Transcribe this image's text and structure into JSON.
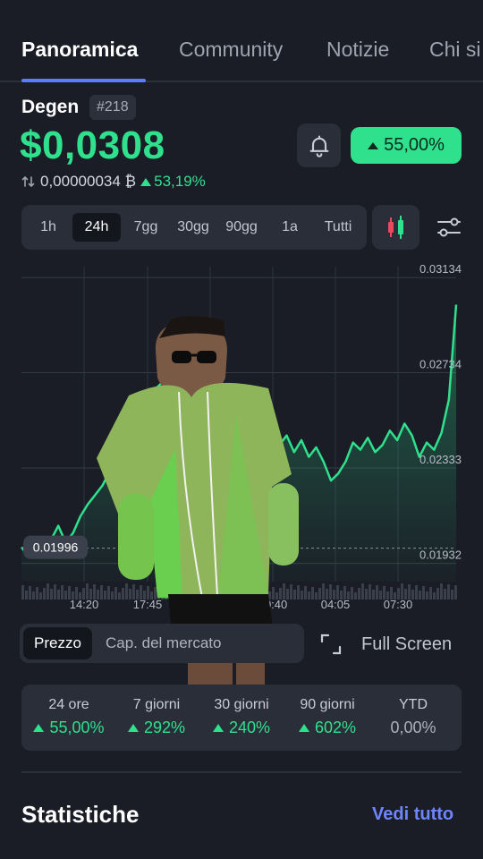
{
  "tabs": [
    {
      "label": "Panoramica",
      "active": true
    },
    {
      "label": "Community",
      "active": false
    },
    {
      "label": "Notizie",
      "active": false
    },
    {
      "label": "Chi si",
      "active": false
    }
  ],
  "coin": {
    "name": "Degen",
    "rank": "#218",
    "price": "$0,0308",
    "change_24h": "55,00%",
    "btc_price": "0,00000034 ₿",
    "btc_change": "53,19%"
  },
  "timeframes": [
    {
      "label": "1h",
      "active": false
    },
    {
      "label": "24h",
      "active": true
    },
    {
      "label": "7gg",
      "active": false
    },
    {
      "label": "30gg",
      "active": false
    },
    {
      "label": "90gg",
      "active": false
    },
    {
      "label": "1a",
      "active": false
    },
    {
      "label": "Tutti",
      "active": false
    }
  ],
  "icons": {
    "bell": "bell-icon",
    "swap": "swap-arrows-icon",
    "candles": "candlestick-icon",
    "settings": "sliders-icon",
    "fullscreen": "expand-icon"
  },
  "chart_data": {
    "type": "line",
    "y_ticks": [
      "0.03134",
      "0.02734",
      "0.02333",
      "0.01932"
    ],
    "x_ticks": [
      "14:20",
      "17:45",
      "21:10",
      "00:40",
      "04:05",
      "07:30"
    ],
    "current_label": "0.01996",
    "ylim": [
      0.0178,
      0.0318
    ],
    "x": [
      "14:20",
      "14:35",
      "14:50",
      "15:05",
      "15:20",
      "15:40",
      "16:00",
      "16:20",
      "16:40",
      "17:00",
      "17:20",
      "17:45",
      "18:10",
      "18:30",
      "19:00",
      "19:20",
      "19:45",
      "20:10",
      "20:35",
      "21:00",
      "21:10",
      "21:30",
      "21:50",
      "22:10",
      "22:30",
      "22:50",
      "23:10",
      "23:30",
      "23:50",
      "00:10",
      "00:40",
      "01:00",
      "01:20",
      "01:40",
      "02:00",
      "02:20",
      "02:40",
      "03:00",
      "03:20",
      "03:40",
      "04:05",
      "04:30",
      "04:50",
      "05:10",
      "05:30",
      "05:50",
      "06:10",
      "06:30",
      "06:50",
      "07:10",
      "07:30",
      "07:50",
      "08:10",
      "08:30",
      "08:50",
      "09:10",
      "09:30",
      "09:50",
      "10:10",
      "10:20"
    ],
    "values": [
      0.02,
      0.0196,
      0.0201,
      0.0198,
      0.0203,
      0.0209,
      0.0202,
      0.0206,
      0.0213,
      0.0218,
      0.0222,
      0.0226,
      0.0232,
      0.0238,
      0.0245,
      0.0252,
      0.0258,
      0.0263,
      0.0266,
      0.0269,
      0.0272,
      0.0268,
      0.0262,
      0.0266,
      0.0258,
      0.026,
      0.0255,
      0.0259,
      0.0252,
      0.0256,
      0.0249,
      0.0254,
      0.0263,
      0.0258,
      0.025,
      0.0243,
      0.0247,
      0.024,
      0.0245,
      0.0238,
      0.0242,
      0.0236,
      0.0228,
      0.0231,
      0.0236,
      0.0244,
      0.0241,
      0.0246,
      0.024,
      0.0243,
      0.0249,
      0.0245,
      0.0252,
      0.0247,
      0.0238,
      0.0244,
      0.0241,
      0.0248,
      0.0262,
      0.0302
    ],
    "grid": true,
    "color": "#2fe08d"
  },
  "chart_view": {
    "options": [
      {
        "label": "Prezzo",
        "active": true
      },
      {
        "label": "Cap. del mercato",
        "active": false
      }
    ],
    "fullscreen_label": "Full Screen"
  },
  "performance": [
    {
      "label": "24 ore",
      "value": "55,00%",
      "up": true
    },
    {
      "label": "7 giorni",
      "value": "292%",
      "up": true
    },
    {
      "label": "30 giorni",
      "value": "240%",
      "up": true
    },
    {
      "label": "90 giorni",
      "value": "602%",
      "up": true
    },
    {
      "label": "YTD",
      "value": "0,00%",
      "up": false
    }
  ],
  "stats": {
    "title": "Statistiche",
    "see_all": "Vedi tutto"
  },
  "colors": {
    "background": "#1a1d26",
    "accent_green": "#2fe08d",
    "accent_blue": "#5b7cff"
  }
}
